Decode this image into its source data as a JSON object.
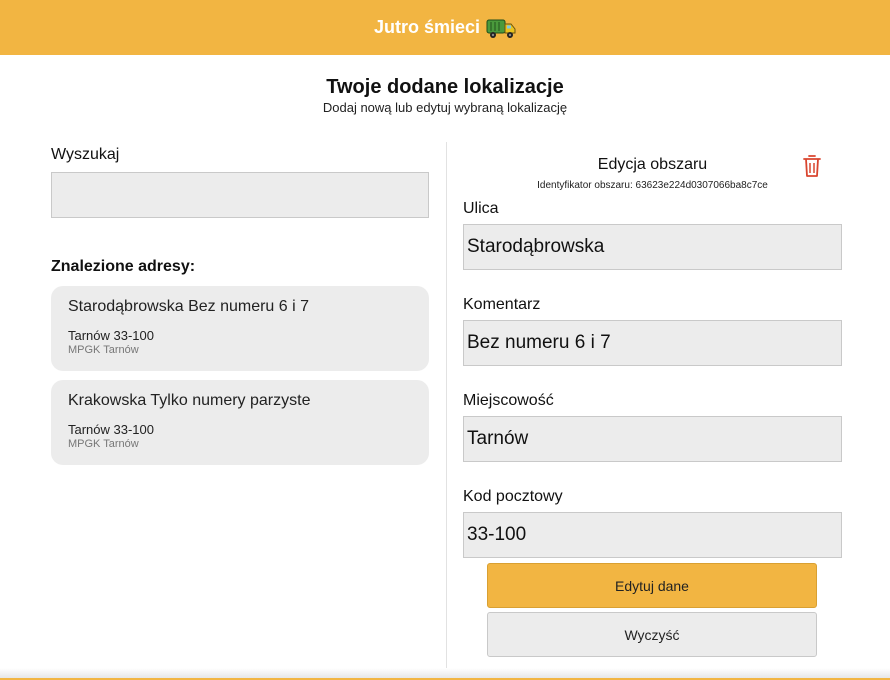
{
  "header": {
    "title": "Jutro śmieci",
    "icon": "garbage-truck-icon",
    "color": "#f2b542"
  },
  "page": {
    "title": "Twoje dodane lokalizacje",
    "subtitle": "Dodaj nową lub edytuj wybraną lokalizację"
  },
  "search": {
    "label": "Wyszukaj",
    "value": "",
    "placeholder": ""
  },
  "results": {
    "heading": "Znalezione adresy:",
    "items": [
      {
        "title": "Starodąbrowska Bez numeru 6 i 7",
        "city": "Tarnów 33-100",
        "company": "MPGK Tarnów"
      },
      {
        "title": "Krakowska Tylko numery parzyste",
        "city": "Tarnów 33-100",
        "company": "MPGK Tarnów"
      }
    ]
  },
  "edit": {
    "title": "Edycja obszaru",
    "id_label": "Identyfikator obszaru: 63623e224d0307066ba8c7ce",
    "delete_icon": "trash-icon",
    "fields": {
      "street": {
        "label": "Ulica",
        "value": "Starodąbrowska"
      },
      "comment": {
        "label": "Komentarz",
        "value": "Bez numeru 6 i 7"
      },
      "city": {
        "label": "Miejscowość",
        "value": "Tarnów"
      },
      "postal": {
        "label": "Kod pocztowy",
        "value": "33-100"
      }
    },
    "primary_button": "Edytuj dane",
    "secondary_button": "Wyczyść"
  }
}
